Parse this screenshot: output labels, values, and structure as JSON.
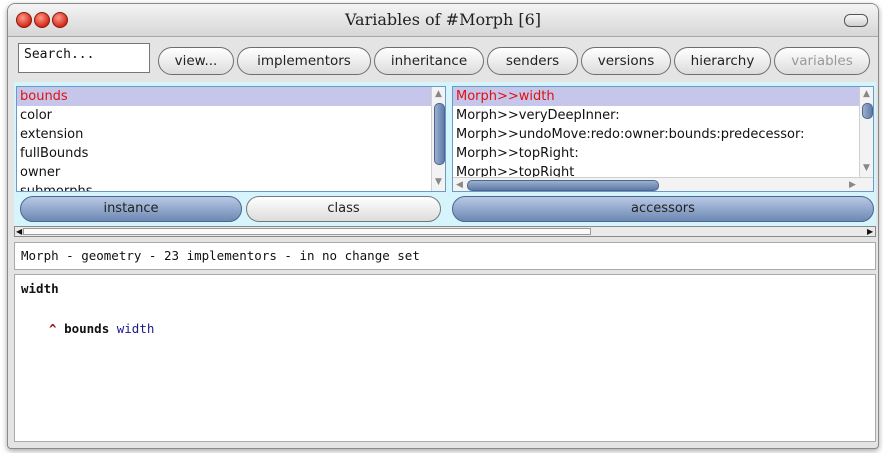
{
  "window": {
    "title": "Variables of #Morph [6]",
    "colors": {
      "close": "#d52a18",
      "selection_bg": "#c6c6ea",
      "selection_text": "#e01010",
      "pane_bg": "#d6f4fb"
    }
  },
  "toolbar": {
    "search_text": "Search...",
    "buttons": [
      {
        "label": "view...",
        "disabled": false
      },
      {
        "label": "implementors",
        "disabled": false
      },
      {
        "label": "inheritance",
        "disabled": false
      },
      {
        "label": "senders",
        "disabled": false
      },
      {
        "label": "versions",
        "disabled": false
      },
      {
        "label": "hierarchy",
        "disabled": false
      },
      {
        "label": "variables",
        "disabled": true
      }
    ]
  },
  "variables_list": {
    "items": [
      "bounds",
      "color",
      "extension",
      "fullBounds",
      "owner",
      "submorphs"
    ],
    "selected": "bounds"
  },
  "methods_list": {
    "items": [
      "Morph>>width",
      "Morph>>veryDeepInner:",
      "Morph>>undoMove:redo:owner:bounds:predecessor:",
      "Morph>>topRight:",
      "Morph>>topRight"
    ],
    "selected": "Morph>>width"
  },
  "toggles": {
    "instance": "instance",
    "class": "class",
    "accessors": "accessors"
  },
  "status": {
    "text": "Morph - geometry - 23 implementors - in no change set"
  },
  "code": {
    "selector": "width",
    "caret": "^",
    "receiver": "bounds",
    "message": "width"
  }
}
